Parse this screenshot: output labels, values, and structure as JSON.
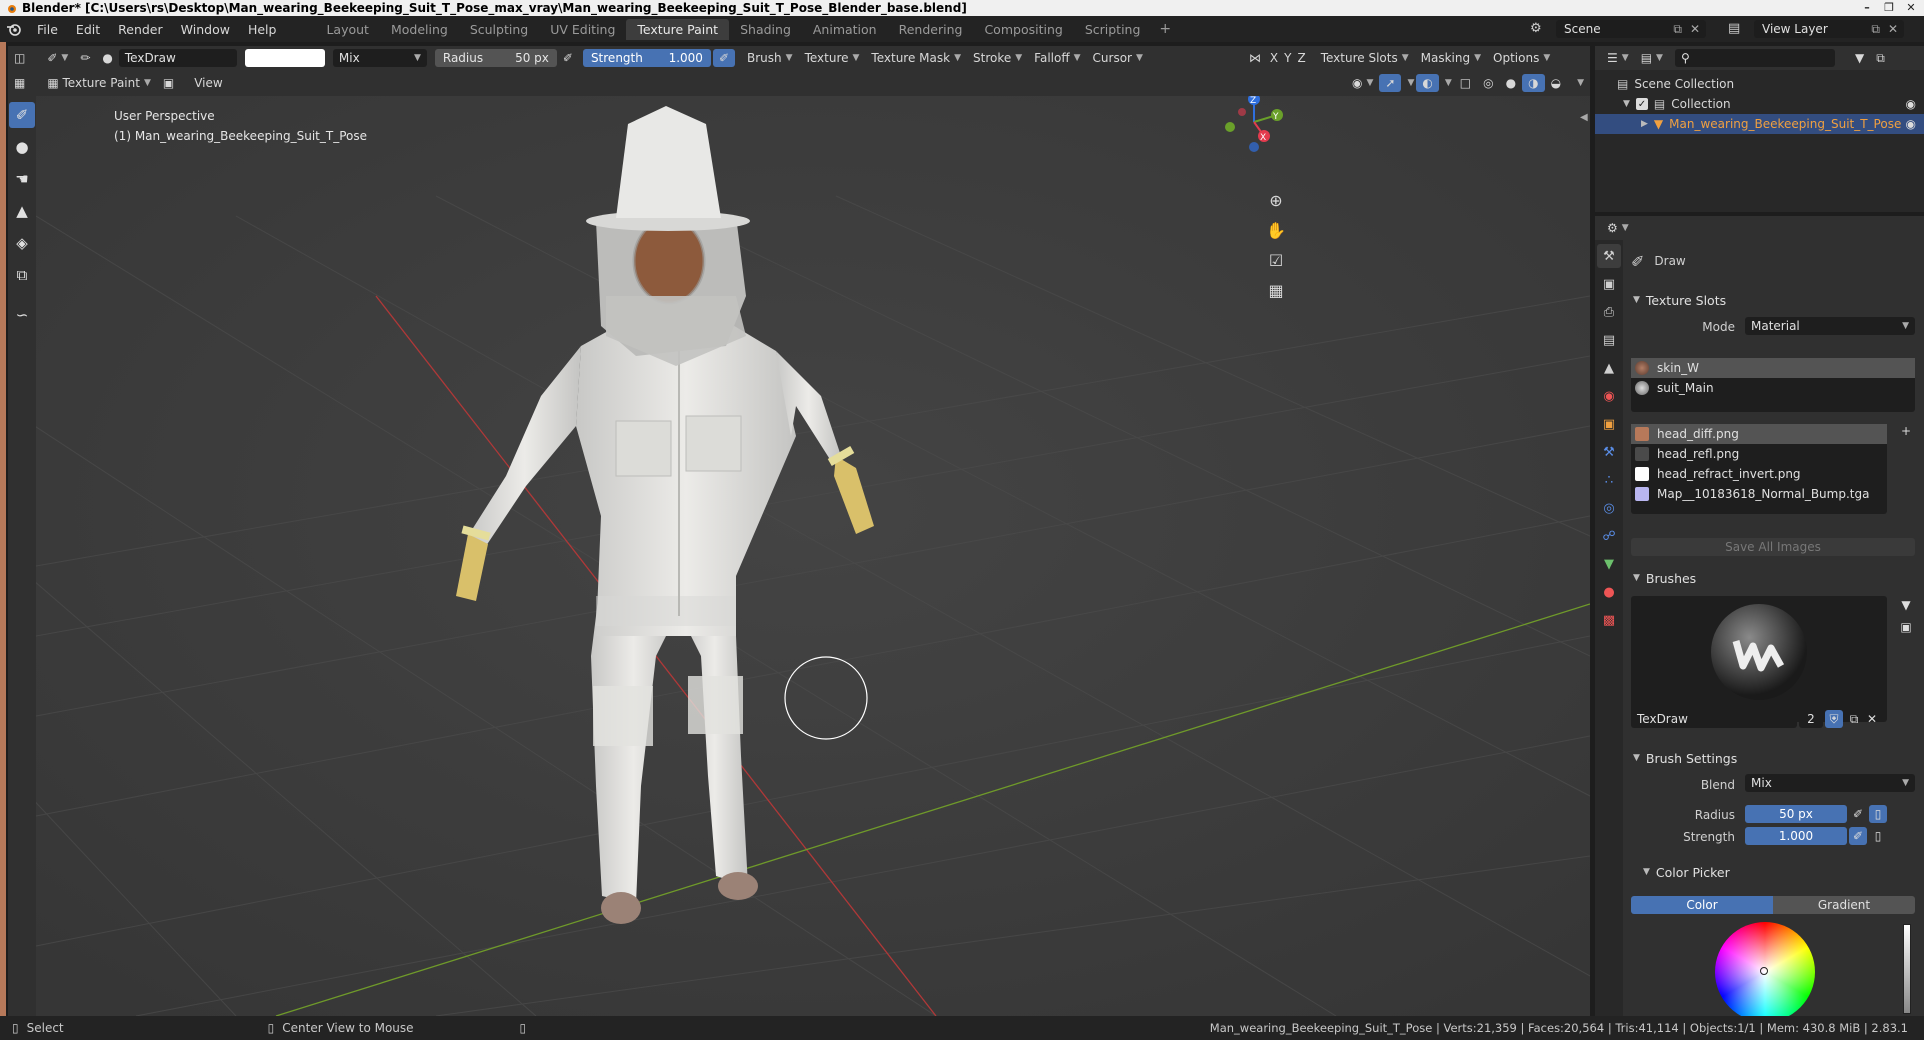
{
  "window": {
    "title": "Blender* [C:\\Users\\rs\\Desktop\\Man_wearing_Beekeeping_Suit_T_Pose_max_vray\\Man_wearing_Beekeeping_Suit_T_Pose_Blender_base.blend]",
    "controls": [
      "–",
      "❐",
      "✕"
    ]
  },
  "menubar": {
    "menus": [
      "File",
      "Edit",
      "Render",
      "Window",
      "Help"
    ],
    "workspaces": [
      "Layout",
      "Modeling",
      "Sculpting",
      "UV Editing",
      "Texture Paint",
      "Shading",
      "Animation",
      "Rendering",
      "Compositing",
      "Scripting"
    ],
    "active_workspace": "Texture Paint",
    "add_workspace": "+",
    "scene": "Scene",
    "view_layer": "View Layer"
  },
  "tool_header": {
    "brush_name": "TexDraw",
    "blend_mode": "Mix",
    "radius_label": "Radius",
    "radius_value": "50 px",
    "strength_label": "Strength",
    "strength_value": "1.000",
    "menus": [
      "Brush",
      "Texture",
      "Texture Mask",
      "Stroke",
      "Falloff",
      "Cursor"
    ],
    "axes": [
      "X",
      "Y",
      "Z"
    ],
    "right_menus": [
      "Texture Slots",
      "Masking",
      "Options"
    ]
  },
  "view_header": {
    "mode": "Texture Paint",
    "view_menu": "View"
  },
  "viewport": {
    "perspective": "User Perspective",
    "object_label": "(1) Man_wearing_Beekeeping_Suit_T_Pose",
    "gizmo_axes": [
      "Z",
      "Y",
      "X"
    ]
  },
  "outliner": {
    "scene_collection": "Scene Collection",
    "collection": "Collection",
    "object": "Man_wearing_Beekeeping_Suit_T_Pose"
  },
  "properties": {
    "tool_name": "Draw",
    "texture_slots": {
      "title": "Texture Slots",
      "mode_label": "Mode",
      "mode_value": "Material",
      "materials": [
        "skin_W",
        "suit_Main"
      ],
      "images": [
        {
          "name": "head_diff.png",
          "color": "#b7795a"
        },
        {
          "name": "head_refl.png",
          "color": "#4a4a4a"
        },
        {
          "name": "head_refract_invert.png",
          "color": "#ffffff"
        },
        {
          "name": "Map__10183618_Normal_Bump.tga",
          "color": "#b9b6f0"
        }
      ],
      "save_all": "Save All Images"
    },
    "brushes": {
      "title": "Brushes",
      "brush_name": "TexDraw",
      "users": "2"
    },
    "brush_settings": {
      "title": "Brush Settings",
      "blend_label": "Blend",
      "blend_value": "Mix",
      "radius_label": "Radius",
      "radius_value": "50 px",
      "strength_label": "Strength",
      "strength_value": "1.000"
    },
    "color_picker": {
      "title": "Color Picker",
      "tabs": [
        "Color",
        "Gradient"
      ],
      "active_tab": "Color"
    }
  },
  "statusbar": {
    "left_action": "Select",
    "middle_action": "Center View to Mouse",
    "stats": "Man_wearing_Beekeeping_Suit_T_Pose | Verts:21,359 | Faces:20,564 | Tris:41,114 | Objects:1/1 | Mem: 430.8 MiB | 2.83.1"
  },
  "colors": {
    "accent": "#4772b3",
    "selection": "#334d80",
    "active_object_text": "#f0a040",
    "skin_strip": "#b7795a"
  }
}
